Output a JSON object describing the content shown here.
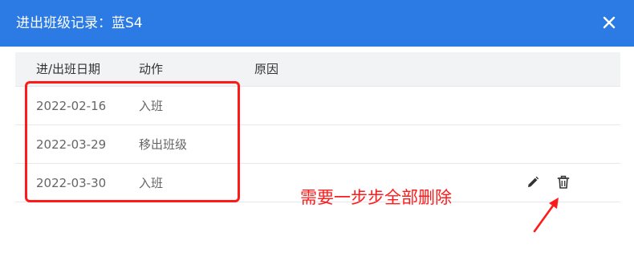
{
  "dialog": {
    "title": "进出班级记录：蓝S4",
    "close_icon": "close-icon"
  },
  "table": {
    "headers": {
      "date": "进/出班日期",
      "action": "动作",
      "reason": "原因"
    },
    "rows": [
      {
        "date": "2022-02-16",
        "action": "入班",
        "reason": ""
      },
      {
        "date": "2022-03-29",
        "action": "移出班级",
        "reason": ""
      },
      {
        "date": "2022-03-30",
        "action": "入班",
        "reason": ""
      }
    ],
    "row_action_icons": [
      "edit-icon",
      "trash-icon"
    ]
  },
  "annotation": {
    "text": "需要一步步全部删除",
    "color": "#ff1a1a"
  },
  "colors": {
    "titlebar": "#2c7be5",
    "header_bg": "#f2f3f5"
  }
}
